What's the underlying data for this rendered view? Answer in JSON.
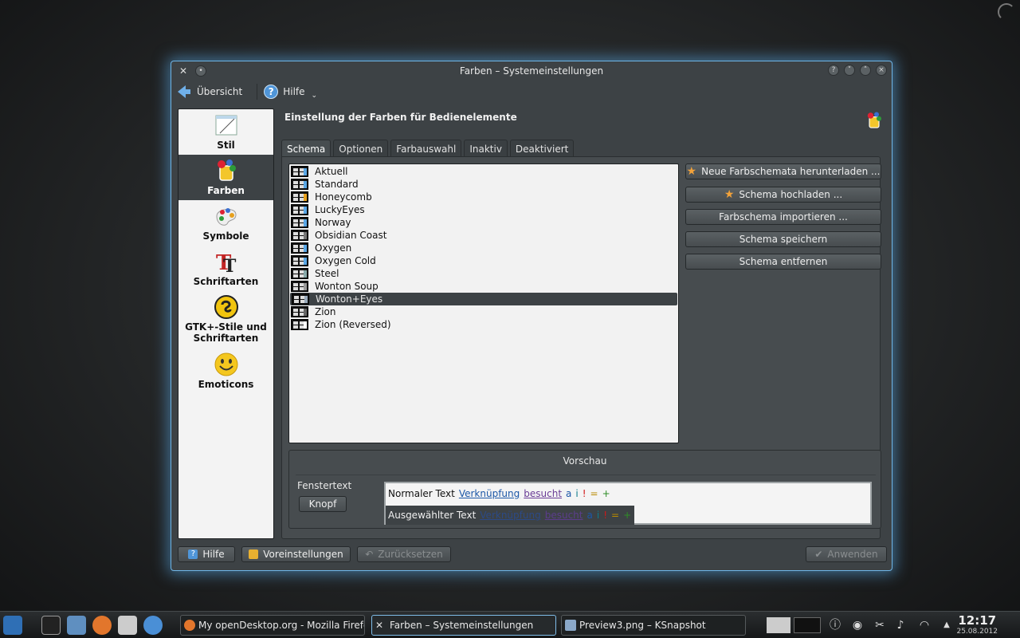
{
  "window": {
    "title": "Farben – Systemeinstellungen",
    "toolbar": {
      "overview": "Übersicht",
      "help": "Hilfe"
    },
    "heading": "Einstellung der Farben für Bedienelemente"
  },
  "sidebar": {
    "items": [
      {
        "label": "Stil",
        "icon": "style-icon"
      },
      {
        "label": "Farben",
        "icon": "colors-icon"
      },
      {
        "label": "Symbole",
        "icon": "icons-icon"
      },
      {
        "label": "Schriftarten",
        "icon": "fonts-icon"
      },
      {
        "label": "GTK+-Stile und Schriftarten",
        "icon": "gtk-icon"
      },
      {
        "label": "Emoticons",
        "icon": "emoticon-icon"
      }
    ],
    "active": "Farben"
  },
  "tabs": [
    "Schema",
    "Optionen",
    "Farbauswahl",
    "Inaktiv",
    "Deaktiviert"
  ],
  "schemes": {
    "items": [
      "Aktuell",
      "Standard",
      "Honeycomb",
      "LuckyEyes",
      "Norway",
      "Obsidian Coast",
      "Oxygen",
      "Oxygen Cold",
      "Steel",
      "Wonton Soup",
      "Wonton+Eyes",
      "Zion",
      "Zion (Reversed)"
    ],
    "selected": "Wonton+Eyes"
  },
  "actions": {
    "download": "Neue Farbschemata herunterladen ...",
    "upload": "Schema hochladen ...",
    "import": "Farbschema importieren ...",
    "save": "Schema speichern",
    "remove": "Schema entfernen"
  },
  "preview": {
    "title": "Vorschau",
    "window_text": "Fenstertext",
    "button": "Knopf",
    "normal_text": "Normaler Text",
    "selected_text": "Ausgewählter Text",
    "link": "Verknüpfung",
    "visited": "besucht",
    "a": "a",
    "i": "i",
    "excl": "!",
    "eq": "=",
    "plus": "+"
  },
  "bottom": {
    "help": "Hilfe",
    "defaults": "Voreinstellungen",
    "reset": "Zurücksetzen",
    "apply": "Anwenden"
  },
  "taskbar": {
    "tasks": [
      "My openDesktop.org - Mozilla Firefox",
      "Farben – Systemeinstellungen",
      "Preview3.png – KSnapshot"
    ],
    "time": "12:17",
    "date": "25.08.2012"
  },
  "colors": {
    "accent": "#6fb6e8",
    "window_bg": "#3d4245",
    "link": "#1c57a7",
    "visited": "#6a3d96"
  }
}
